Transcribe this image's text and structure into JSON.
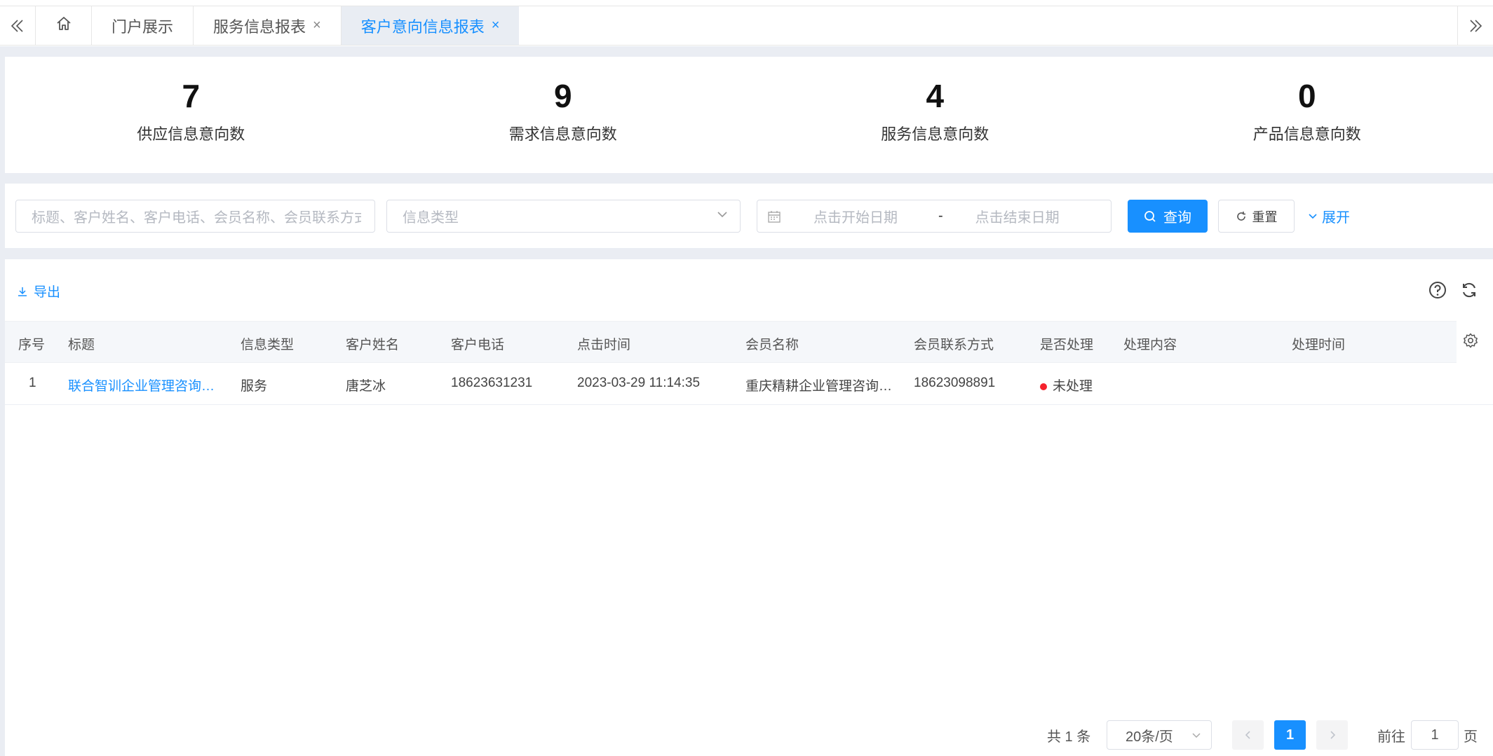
{
  "tabs": {
    "items": [
      {
        "label": "门户展示",
        "closable": false
      },
      {
        "label": "服务信息报表",
        "closable": true
      },
      {
        "label": "客户意向信息报表",
        "closable": true,
        "active": true
      }
    ],
    "close_glyph": "×"
  },
  "stats": [
    {
      "value": "7",
      "label": "供应信息意向数"
    },
    {
      "value": "9",
      "label": "需求信息意向数"
    },
    {
      "value": "4",
      "label": "服务信息意向数"
    },
    {
      "value": "0",
      "label": "产品信息意向数"
    }
  ],
  "filter": {
    "search_placeholder": "标题、客户姓名、客户电话、会员名称、会员联系方式",
    "type_placeholder": "信息类型",
    "date_start_placeholder": "点击开始日期",
    "date_separator": "-",
    "date_end_placeholder": "点击结束日期",
    "query_label": "查询",
    "reset_label": "重置",
    "expand_label": "展开"
  },
  "toolbar": {
    "export_label": "导出"
  },
  "table": {
    "columns": [
      "序号",
      "标题",
      "信息类型",
      "客户姓名",
      "客户电话",
      "点击时间",
      "会员名称",
      "会员联系方式",
      "是否处理",
      "处理内容",
      "处理时间"
    ],
    "rows": [
      {
        "index": "1",
        "title": "联合智训企业管理咨询…",
        "type": "服务",
        "customer_name": "唐芝冰",
        "customer_phone": "18623631231",
        "click_time": "2023-03-29 11:14:35",
        "member_name": "重庆精耕企业管理咨询…",
        "member_contact": "18623098891",
        "status": "未处理",
        "status_color": "#f5222d",
        "content": "",
        "process_time": ""
      }
    ]
  },
  "pagination": {
    "total_text": "共 1 条",
    "page_size": "20条/页",
    "current_page": "1",
    "goto_prefix": "前往",
    "goto_value": "1",
    "goto_suffix": "页"
  },
  "colors": {
    "primary": "#1890ff",
    "background_band": "#eaedf3",
    "status_unprocessed": "#f5222d"
  }
}
